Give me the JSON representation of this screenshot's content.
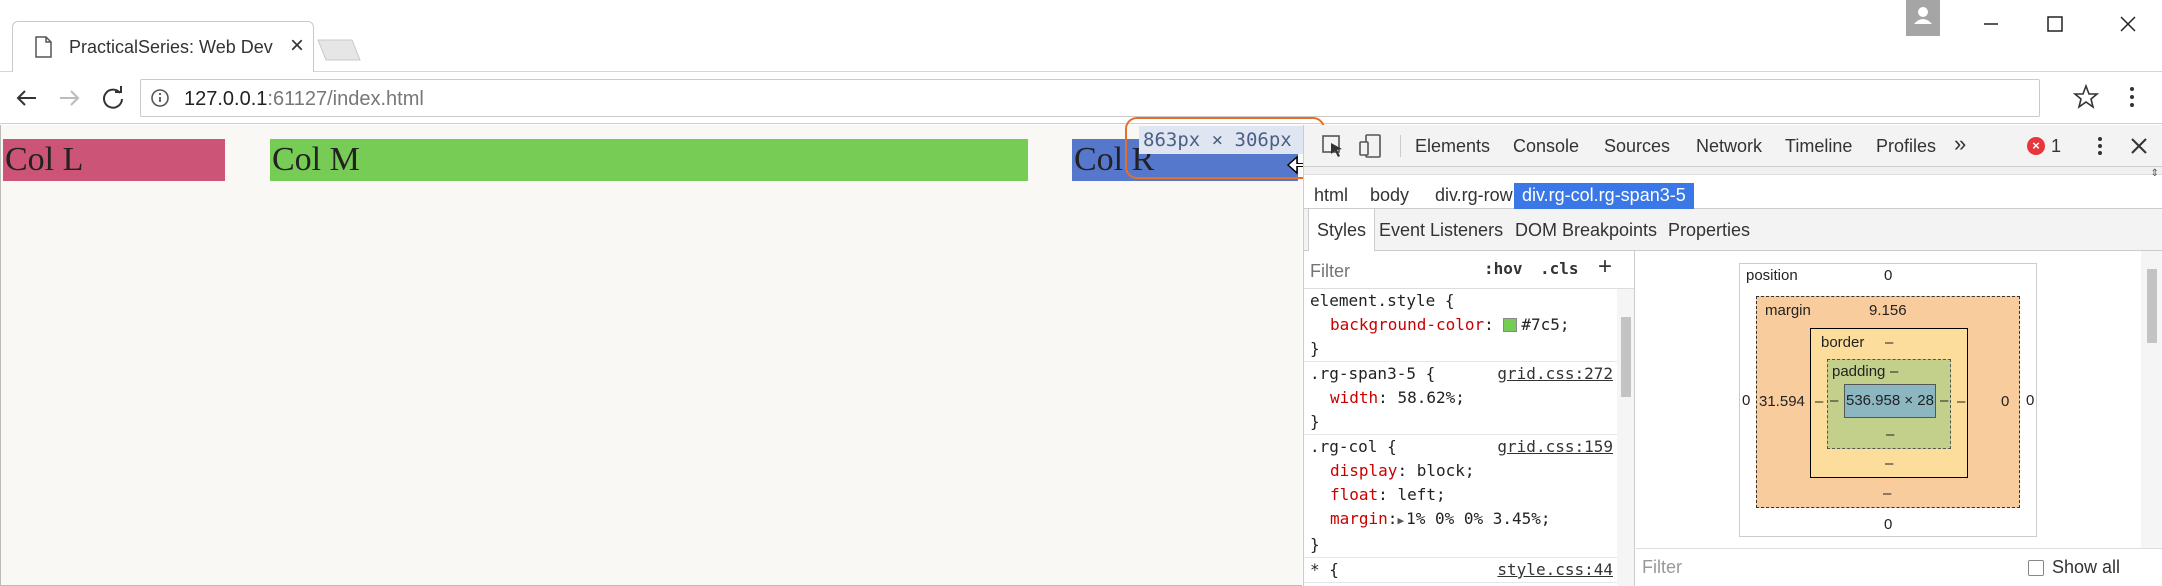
{
  "browser": {
    "tab_title": "PracticalSeries: Web Development",
    "url_host": "127.0.0.1",
    "url_rest": ":61127/index.html"
  },
  "page": {
    "col_l": "Col L",
    "col_m": "Col M",
    "col_r": "Col R",
    "size_tooltip": "863px × 306px"
  },
  "devtools": {
    "tabs": [
      "Elements",
      "Console",
      "Sources",
      "Network",
      "Timeline",
      "Profiles"
    ],
    "more_tabs": "»",
    "error_count": "1",
    "breadcrumbs": [
      "html",
      "body",
      "div.rg-row",
      "div.rg-col.rg-span3-5"
    ],
    "subtabs": [
      "Styles",
      "Event Listeners",
      "DOM Breakpoints",
      "Properties"
    ],
    "filter_placeholder": "Filter",
    "hov": ":hov",
    "cls": ".cls",
    "add_rule": "+",
    "rules": [
      {
        "selector": "element.style {",
        "source": "",
        "props": [
          {
            "name": "background-color",
            "value": "#7c5;",
            "swatch": "#77cc55"
          }
        ],
        "close": "}"
      },
      {
        "selector": ".rg-span3-5 {",
        "source": "grid.css:272",
        "props": [
          {
            "name": "width",
            "value": "58.62%;"
          }
        ],
        "close": "}"
      },
      {
        "selector": ".rg-col {",
        "source": "grid.css:159",
        "props": [
          {
            "name": "display",
            "value": "block;"
          },
          {
            "name": "float",
            "value": "left;"
          },
          {
            "name": "margin",
            "value": "1% 0% 0% 3.45%;",
            "expandable": true
          }
        ],
        "close": "}"
      },
      {
        "selector": "* {",
        "source": "style.css:44",
        "props": [],
        "close": ""
      }
    ],
    "box_model": {
      "position_label": "position",
      "position_value": "0",
      "margin_label": "margin",
      "margin_top": "9.156",
      "margin_left": "31.594",
      "margin_right": "0",
      "margin_bottom": "–",
      "outer_left": "0",
      "outer_right": "0",
      "outer_bottom": "0",
      "border_label": "border",
      "border_value": "–",
      "border_left": "–",
      "border_right": "–",
      "border_bottom": "–",
      "padding_label": "padding",
      "padding_value": "–",
      "padding_left": "–",
      "padding_right": "–",
      "padding_bottom": "–",
      "content": "536.958 × 28"
    },
    "bottom_filter": "Filter",
    "show_all": "Show all"
  },
  "colors": {
    "col_l": "#cc5577",
    "col_m": "#77cc55",
    "col_r": "#5577cc",
    "highlight": "#3b78e7",
    "tooltip_ring": "#e36f2b"
  }
}
